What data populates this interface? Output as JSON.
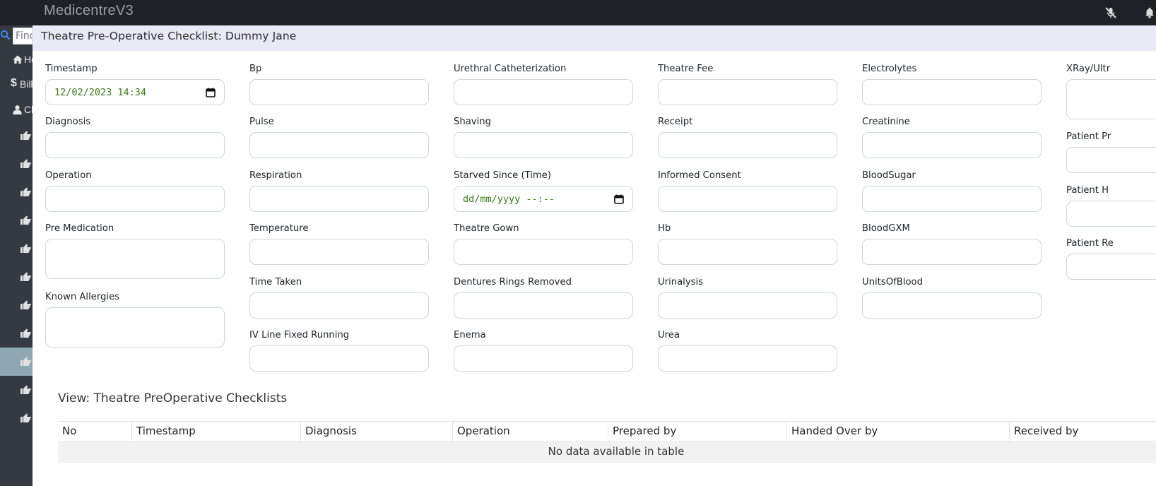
{
  "app": {
    "brand": "MedicentreV3"
  },
  "topbar_icons": [
    "mute-icon",
    "bell-icon"
  ],
  "sidebar": {
    "search_placeholder": "Find",
    "items": [
      {
        "icon": "home-icon",
        "label": "Home"
      },
      {
        "icon": "dollar-icon",
        "label": "Billing"
      },
      {
        "icon": "user-icon",
        "label": "Clinic"
      }
    ],
    "subitem_icon": "hand-point-right-icon",
    "subitem_count": 11,
    "active_subitem_index": 8
  },
  "modal": {
    "title": "Theatre Pre-Operative Checklist: Dummy Jane",
    "columns": [
      [
        {
          "label": "Timestamp",
          "type": "datetime",
          "value": "12/02/2023 14:34"
        },
        {
          "label": "Diagnosis",
          "type": "text",
          "value": ""
        },
        {
          "label": "Operation",
          "type": "text",
          "value": ""
        },
        {
          "label": "Pre Medication",
          "type": "textarea",
          "value": ""
        },
        {
          "label": "Known Allergies",
          "type": "textarea",
          "value": ""
        }
      ],
      [
        {
          "label": "Bp",
          "type": "text",
          "value": ""
        },
        {
          "label": "Pulse",
          "type": "text",
          "value": ""
        },
        {
          "label": "Respiration",
          "type": "text",
          "value": ""
        },
        {
          "label": "Temperature",
          "type": "text",
          "value": ""
        },
        {
          "label": "Time Taken",
          "type": "text",
          "value": ""
        },
        {
          "label": "IV Line Fixed Running",
          "type": "text",
          "value": ""
        }
      ],
      [
        {
          "label": "Urethral Catheterization",
          "type": "text",
          "value": ""
        },
        {
          "label": "Shaving",
          "type": "text",
          "value": ""
        },
        {
          "label": "Starved Since (Time)",
          "type": "datetime",
          "value": "dd/mm/yyyy --:--"
        },
        {
          "label": "Theatre Gown",
          "type": "text",
          "value": ""
        },
        {
          "label": "Dentures Rings Removed",
          "type": "text",
          "value": ""
        },
        {
          "label": "Enema",
          "type": "text",
          "value": ""
        }
      ],
      [
        {
          "label": "Theatre Fee",
          "type": "text",
          "value": ""
        },
        {
          "label": "Receipt",
          "type": "text",
          "value": ""
        },
        {
          "label": "Informed Consent",
          "type": "text",
          "value": ""
        },
        {
          "label": "Hb",
          "type": "text",
          "value": ""
        },
        {
          "label": "Urinalysis",
          "type": "text",
          "value": ""
        },
        {
          "label": "Urea",
          "type": "text",
          "value": ""
        }
      ],
      [
        {
          "label": "Electrolytes",
          "type": "text",
          "value": ""
        },
        {
          "label": "Creatinine",
          "type": "text",
          "value": ""
        },
        {
          "label": "BloodSugar",
          "type": "text",
          "value": ""
        },
        {
          "label": "BloodGXM",
          "type": "text",
          "value": ""
        },
        {
          "label": "UnitsOfBlood",
          "type": "text",
          "value": ""
        }
      ],
      [
        {
          "label": "XRay/Ultr",
          "type": "textarea",
          "value": ""
        },
        {
          "label": "Patient Pr",
          "type": "text",
          "value": ""
        },
        {
          "label": "Patient H",
          "type": "text",
          "value": ""
        },
        {
          "label": "Patient Re",
          "type": "text",
          "value": ""
        }
      ]
    ],
    "view_title": "View: Theatre PreOperative Checklists",
    "table": {
      "headers": [
        "No",
        "Timestamp",
        "Diagnosis",
        "Operation",
        "Prepared by",
        "Handed Over by",
        "Received by"
      ],
      "empty_text": "No data available in table"
    }
  }
}
